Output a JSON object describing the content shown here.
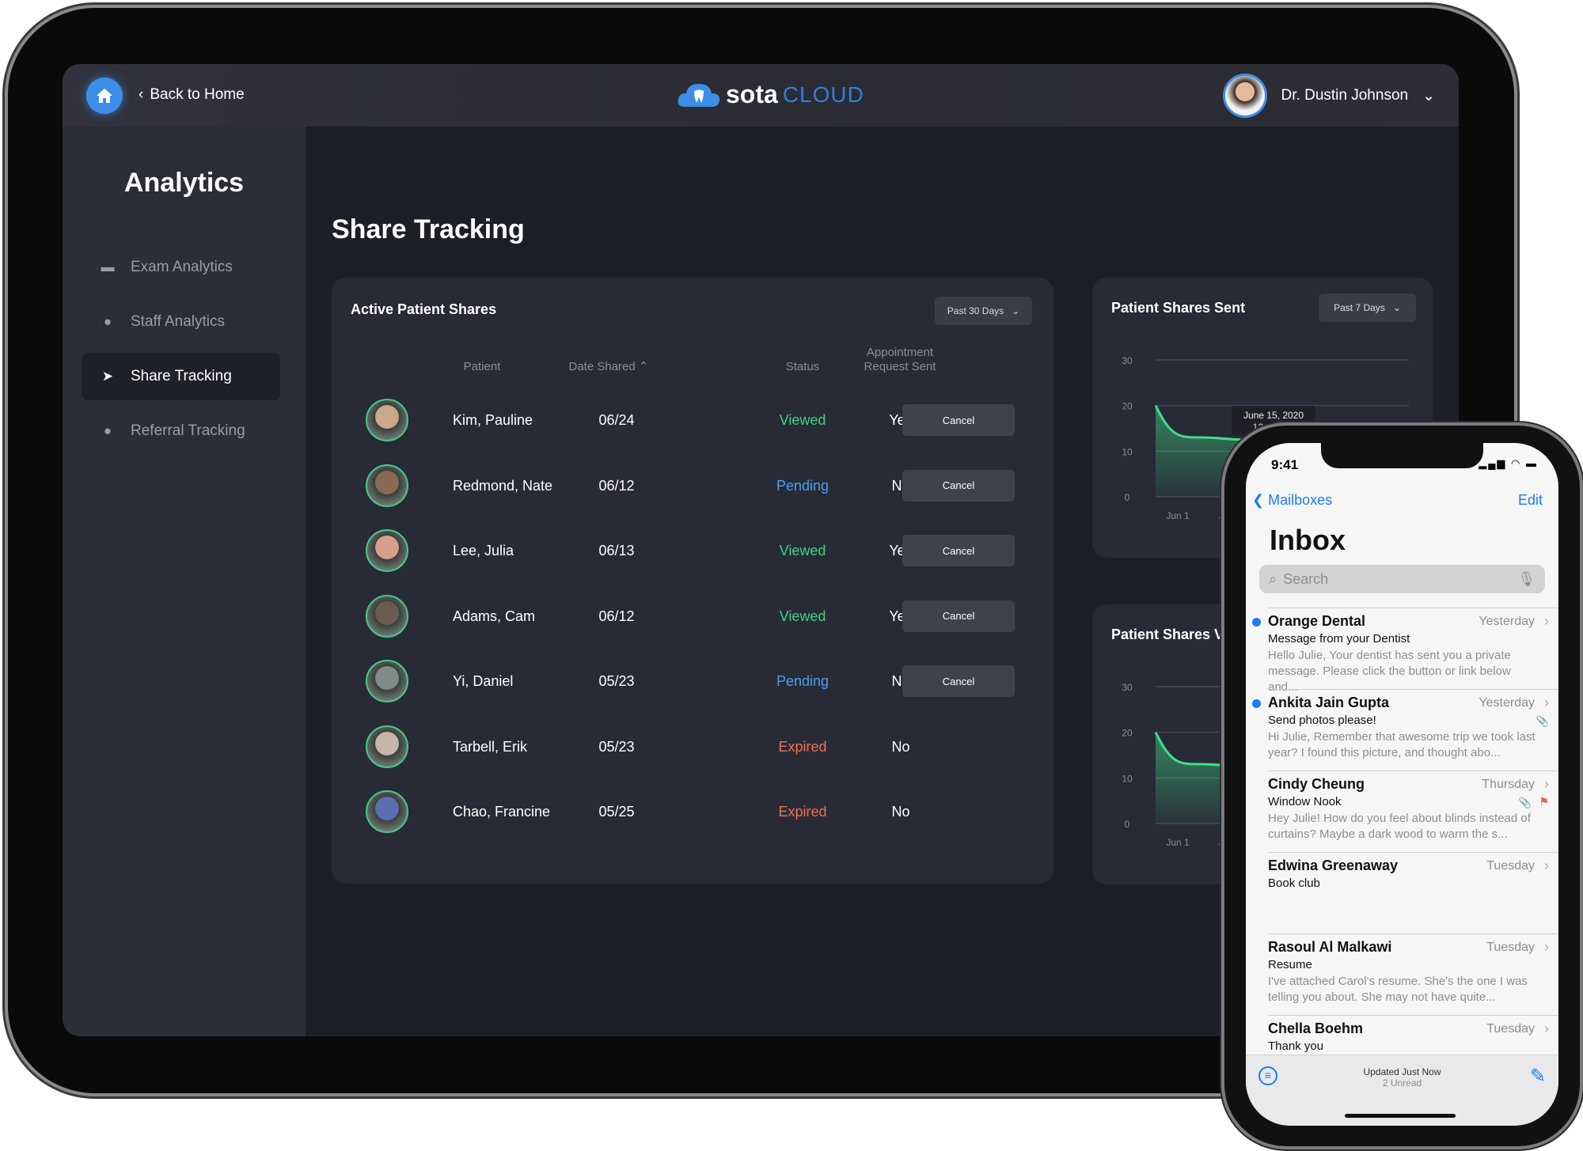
{
  "header": {
    "back_label": "Back to Home",
    "logo_main": "sota",
    "logo_sub": "CLOUD",
    "user_name": "Dr. Dustin Johnson"
  },
  "sidebar": {
    "title": "Analytics",
    "items": [
      {
        "label": "Exam Analytics",
        "icon": "folder-icon"
      },
      {
        "label": "Staff Analytics",
        "icon": "person-icon"
      },
      {
        "label": "Share Tracking",
        "icon": "paper-plane-icon",
        "active": true
      },
      {
        "label": "Referral Tracking",
        "icon": "person-icon"
      }
    ]
  },
  "page": {
    "title": "Share Tracking"
  },
  "shares": {
    "title": "Active Patient Shares",
    "range": "Past 30 Days",
    "columns": {
      "patient": "Patient",
      "date": "Date Shared",
      "status": "Status",
      "appt1": "Appointment",
      "appt2": "Request Sent"
    },
    "rows": [
      {
        "name": "Kim, Pauline",
        "date": "06/24",
        "status": "Viewed",
        "appt": "Yes",
        "action": "Cancel"
      },
      {
        "name": "Redmond, Nate",
        "date": "06/12",
        "status": "Pending",
        "appt": "No",
        "action": "Cancel"
      },
      {
        "name": "Lee, Julia",
        "date": "06/13",
        "status": "Viewed",
        "appt": "Yes",
        "action": "Cancel"
      },
      {
        "name": "Adams, Cam",
        "date": "06/12",
        "status": "Viewed",
        "appt": "Yes",
        "action": "Cancel"
      },
      {
        "name": "Yi, Daniel",
        "date": "05/23",
        "status": "Pending",
        "appt": "No",
        "action": "Cancel"
      },
      {
        "name": "Tarbell, Erik",
        "date": "05/23",
        "status": "Expired",
        "appt": "No"
      },
      {
        "name": "Chao, Francine",
        "date": "05/25",
        "status": "Expired",
        "appt": "No"
      }
    ]
  },
  "status_colors": {
    "Viewed": "#3fd37f",
    "Pending": "#4a9ff0",
    "Expired": "#f0704f"
  },
  "chart_data": [
    {
      "type": "area",
      "title": "Patient Shares Sent",
      "range": "Past 7 Days",
      "yticks": [
        0,
        10,
        20,
        30
      ],
      "ylim": [
        0,
        30
      ],
      "xticks": [
        "Jun 1",
        "Ju"
      ],
      "values": [
        20,
        13,
        12.5,
        13,
        13
      ],
      "tooltip": {
        "date": "June 15, 2020",
        "value": "12 shares"
      },
      "color": "#3fe08a"
    },
    {
      "type": "area",
      "title": "Patient Shares Vie",
      "yticks": [
        0,
        10,
        20,
        30
      ],
      "ylim": [
        0,
        30
      ],
      "xticks": [
        "Jun 1",
        "Ju"
      ],
      "values": [
        20,
        13,
        12.5,
        13,
        13
      ],
      "color": "#3fe08a"
    }
  ],
  "phone": {
    "time": "9:41",
    "back": "Mailboxes",
    "edit": "Edit",
    "title": "Inbox",
    "search_placeholder": "Search",
    "mails": [
      {
        "from": "Orange Dental",
        "date": "Yesterday",
        "subject": "Message from your Dentist",
        "preview": "Hello Julie, Your dentist has sent you a private message. Please click the button or link below and...",
        "unread": true
      },
      {
        "from": "Ankita Jain Gupta",
        "date": "Yesterday",
        "subject": "Send photos please!",
        "preview": "Hi Julie, Remember that awesome trip we took last year? I found this picture, and thought abo...",
        "unread": true,
        "attachment": true
      },
      {
        "from": "Cindy Cheung",
        "date": "Thursday",
        "subject": "Window Nook",
        "preview": "Hey Julie! How do you feel about blinds instead of curtains? Maybe a dark wood to warm the s...",
        "attachment": true,
        "flag": true
      },
      {
        "from": "Edwina Greenaway",
        "date": "Tuesday",
        "subject": "Book club",
        "preview": ""
      },
      {
        "from": "Rasoul Al Malkawi",
        "date": "Tuesday",
        "subject": "Resume",
        "preview": "I've attached Carol's resume. She's the one I was telling you about. She may not have quite..."
      },
      {
        "from": "Chella Boehm",
        "date": "Tuesday",
        "subject": "Thank you",
        "preview": ""
      }
    ],
    "status1": "Updated Just Now",
    "status2": "2 Unread"
  }
}
